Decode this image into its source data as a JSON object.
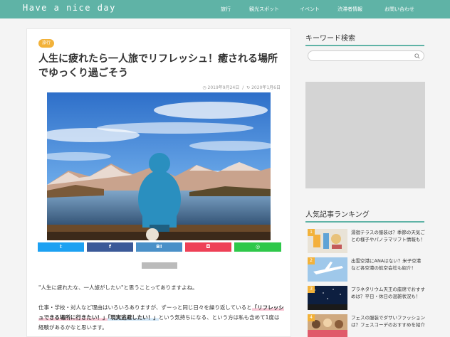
{
  "header": {
    "site_title": "Have a nice day",
    "nav": [
      {
        "label": "旅行"
      },
      {
        "label": "観光スポット"
      },
      {
        "label": "イベント"
      },
      {
        "label": "渋滞者情報"
      },
      {
        "label": "お問い合わせ"
      }
    ]
  },
  "article": {
    "category": "旅行",
    "title": "人生に疲れたら一人旅でリフレッシュ！癒される場所でゆっくり過ごそう",
    "published": "2019年9月24日",
    "separator": "/",
    "updated": "2020年1月6日",
    "share": [
      {
        "label": "𝕥",
        "icon": "twitter-icon",
        "color": "#1da1f2"
      },
      {
        "label": "f",
        "icon": "facebook-icon",
        "color": "#3b5998"
      },
      {
        "label": "B!",
        "icon": "hatena-icon",
        "color": "#4a90c8"
      },
      {
        "label": "◘",
        "icon": "pocket-icon",
        "color": "#ee4056"
      },
      {
        "label": "◎",
        "icon": "line-icon",
        "color": "#2ec84a"
      }
    ],
    "paragraph1": "\"人生に疲れたな、一人旅がしたい\"と思うことってありますよね。",
    "paragraph2_before": "仕事・学校・対人など理由はいろいろありますが、ずーっと同じ日々を繰り返していると",
    "paragraph2_highlight1": "「リフレッシュできる場所に行きたい！」",
    "paragraph2_highlight2": "「現実逃避したい！」",
    "paragraph2_after": "という気持ちになる、という方は私も含めて1度は経験があるかなと思います。"
  },
  "sidebar": {
    "keyword_heading": "キーワード検索",
    "search_placeholder": "",
    "ranking_heading": "人気記事ランキング",
    "ranking": [
      {
        "rank": "1",
        "title": "湯宿テラスの服装は？季節の天気ごとの様子やパノラマリフト情報も！"
      },
      {
        "rank": "2",
        "title": "出雲空港にANAはない？米子空港など各空港の航空会社も紹介！"
      },
      {
        "rank": "3",
        "title": "プラネタリウム天王の座席でおすすめは？平日・休日の混雑状況も！"
      },
      {
        "rank": "4",
        "title": "フェスの服装でダサいファッションは？フェスコーデのおすすめを紹介"
      }
    ]
  }
}
